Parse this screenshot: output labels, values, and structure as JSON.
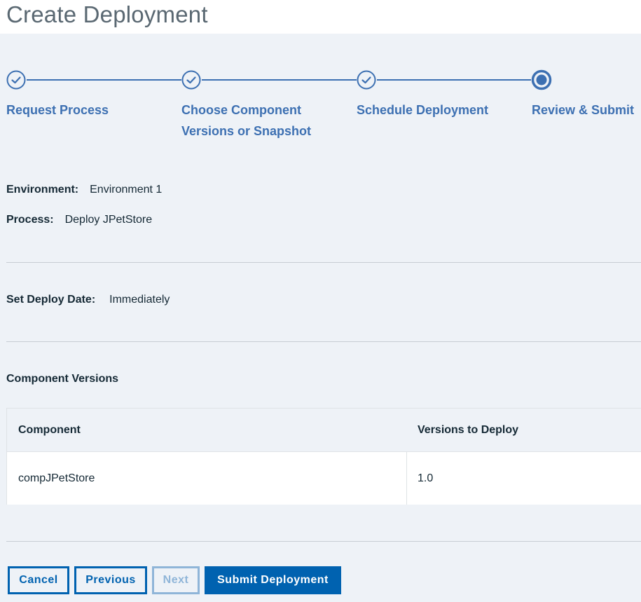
{
  "page": {
    "title": "Create Deployment"
  },
  "stepper": {
    "colors": {
      "accent": "#3d70b2"
    },
    "steps": [
      {
        "label": "Request Process",
        "status": "complete",
        "icon": "checkmark-circle-icon"
      },
      {
        "label": "Choose Component Versions or Snapshot",
        "status": "complete",
        "icon": "checkmark-circle-icon"
      },
      {
        "label": "Schedule Deployment",
        "status": "complete",
        "icon": "checkmark-circle-icon"
      },
      {
        "label": "Review & Submit",
        "status": "current",
        "icon": "current-step-icon"
      }
    ]
  },
  "summary": {
    "environment": {
      "label": "Environment:",
      "value": "Environment 1"
    },
    "process": {
      "label": "Process:",
      "value": "Deploy JPetStore"
    },
    "deploy_date": {
      "label": "Set Deploy Date:",
      "value": "Immediately"
    }
  },
  "component_versions": {
    "title": "Component Versions",
    "columns": [
      "Component",
      "Versions to Deploy"
    ],
    "rows": [
      {
        "component": "compJPetStore",
        "version": "1.0"
      }
    ]
  },
  "actions": {
    "cancel": "Cancel",
    "previous": "Previous",
    "next": "Next",
    "submit": "Submit Deployment",
    "next_disabled": true,
    "colors": {
      "primary": "#0062b0",
      "disabled": "#8fb5d8"
    }
  }
}
